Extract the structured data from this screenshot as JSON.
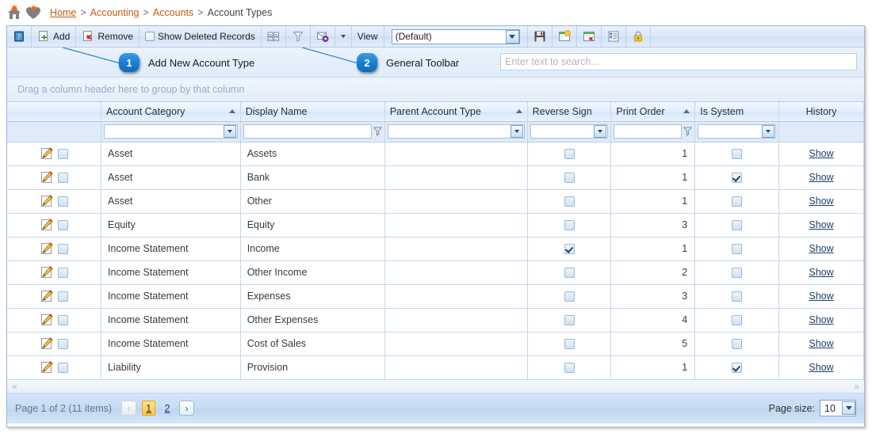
{
  "breadcrumb": {
    "home": "Home",
    "sep": ">",
    "accounting": "Accounting",
    "accounts": "Accounts",
    "current": "Account Types"
  },
  "toolbar": {
    "help_icon": "help-book-icon",
    "add_label": "Add",
    "remove_label": "Remove",
    "show_deleted_label": "Show Deleted Records",
    "column_chooser_icon": "column-chooser-icon",
    "filter_icon": "filter-funnel-icon",
    "export_icon": "export-mail-icon",
    "export_dropdown_icon": "chevron-down-icon",
    "view_label": "View",
    "view_value": "(Default)",
    "save_icon": "save-floppy-icon",
    "new_view_icon": "new-view-icon",
    "delete_view_icon": "delete-view-icon",
    "view_properties_icon": "view-properties-icon",
    "lock_icon": "lock-icon"
  },
  "callouts": [
    {
      "number": "1",
      "text": "Add New Account Type"
    },
    {
      "number": "2",
      "text": "General Toolbar"
    }
  ],
  "search": {
    "placeholder": "Enter text to search...",
    "value": ""
  },
  "group_panel": {
    "text": "Drag a column header here to group by that column"
  },
  "grid": {
    "columns": [
      {
        "key": "cmd",
        "label": "",
        "sorted": "",
        "align": "center",
        "filter": "none"
      },
      {
        "key": "account_category",
        "label": "Account Category",
        "sorted": "asc",
        "align": "left",
        "filter": "combo"
      },
      {
        "key": "display_name",
        "label": "Display Name",
        "sorted": "",
        "align": "left",
        "filter": "text"
      },
      {
        "key": "parent_account_type",
        "label": "Parent Account Type",
        "sorted": "asc",
        "align": "left",
        "filter": "combo"
      },
      {
        "key": "reverse_sign",
        "label": "Reverse Sign",
        "sorted": "",
        "align": "center",
        "filter": "combo"
      },
      {
        "key": "print_order",
        "label": "Print Order",
        "sorted": "asc",
        "align": "left",
        "filter": "text"
      },
      {
        "key": "is_system",
        "label": "Is System",
        "sorted": "",
        "align": "left",
        "filter": "combo"
      },
      {
        "key": "history",
        "label": "History",
        "sorted": "",
        "align": "center",
        "filter": "none"
      }
    ],
    "row_edit_icon": "edit-pencil-icon",
    "history_link_label": "Show",
    "rows": [
      {
        "account_category": "Asset",
        "display_name": "Assets",
        "parent_account_type": "",
        "reverse_sign": false,
        "print_order": "1",
        "is_system": false,
        "history": "Show"
      },
      {
        "account_category": "Asset",
        "display_name": "Bank",
        "parent_account_type": "",
        "reverse_sign": false,
        "print_order": "1",
        "is_system": true,
        "history": "Show"
      },
      {
        "account_category": "Asset",
        "display_name": "Other",
        "parent_account_type": "",
        "reverse_sign": false,
        "print_order": "1",
        "is_system": false,
        "history": "Show"
      },
      {
        "account_category": "Equity",
        "display_name": "Equity",
        "parent_account_type": "",
        "reverse_sign": false,
        "print_order": "3",
        "is_system": false,
        "history": "Show"
      },
      {
        "account_category": "Income Statement",
        "display_name": "Income",
        "parent_account_type": "",
        "reverse_sign": true,
        "print_order": "1",
        "is_system": false,
        "history": "Show"
      },
      {
        "account_category": "Income Statement",
        "display_name": "Other Income",
        "parent_account_type": "",
        "reverse_sign": false,
        "print_order": "2",
        "is_system": false,
        "history": "Show"
      },
      {
        "account_category": "Income Statement",
        "display_name": "Expenses",
        "parent_account_type": "",
        "reverse_sign": false,
        "print_order": "3",
        "is_system": false,
        "history": "Show"
      },
      {
        "account_category": "Income Statement",
        "display_name": "Other Expenses",
        "parent_account_type": "",
        "reverse_sign": false,
        "print_order": "4",
        "is_system": false,
        "history": "Show"
      },
      {
        "account_category": "Income Statement",
        "display_name": "Cost of Sales",
        "parent_account_type": "",
        "reverse_sign": false,
        "print_order": "5",
        "is_system": false,
        "history": "Show"
      },
      {
        "account_category": "Liability",
        "display_name": "Provision",
        "parent_account_type": "",
        "reverse_sign": false,
        "print_order": "1",
        "is_system": true,
        "history": "Show"
      }
    ]
  },
  "pager": {
    "info": "Page 1 of 2 (11 items)",
    "prev_label": "‹",
    "next_label": "›",
    "pages": [
      {
        "label": "1",
        "active": true
      },
      {
        "label": "2",
        "active": false
      }
    ],
    "page_size_label": "Page size:",
    "page_size_value": "10"
  },
  "colors": {
    "accent_orange": "#c55a11",
    "badge_blue": "#1a7fd4",
    "grid_border": "#c6d8ea",
    "active_page": "#ffc94d"
  }
}
